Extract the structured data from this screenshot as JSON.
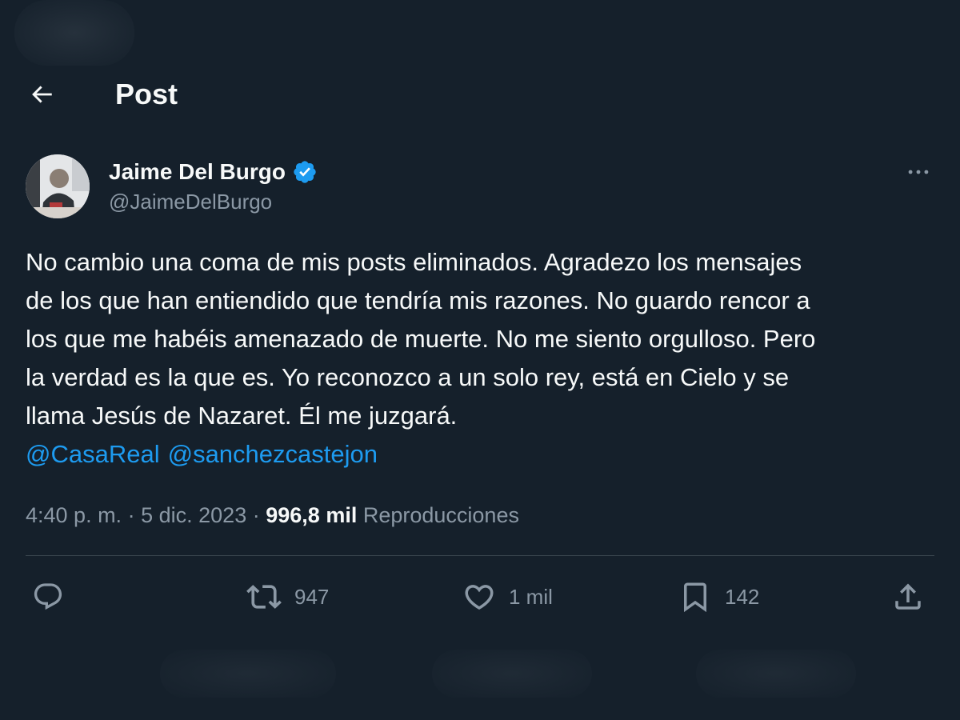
{
  "header": {
    "title": "Post",
    "back_icon": "arrow-left-icon"
  },
  "author": {
    "name": "Jaime Del Burgo",
    "handle": "@JaimeDelBurgo",
    "verified": true,
    "verified_color": "#1d9bf0"
  },
  "tweet": {
    "lines": [
      "No cambio una coma de mis posts eliminados. Agradezo los mensajes",
      "de los que han entiendido que tendría mis razones. No guardo rencor a",
      "los que me habéis amenazado de muerte. No me siento orgulloso. Pero",
      "la verdad es la que es. Yo reconozco a un solo rey, está en Cielo y se",
      "llama Jesús de Nazaret. Él me juzgará."
    ],
    "mentions": [
      "@CasaReal",
      "@sanchezcastejon"
    ]
  },
  "meta": {
    "time": "4:40 p. m.",
    "separator": "·",
    "date": "5 dic. 2023",
    "views_count": "996,8 mil",
    "views_label": "Reproducciones"
  },
  "actions": {
    "reply": {
      "icon": "reply-icon",
      "count": ""
    },
    "repost": {
      "icon": "repost-icon",
      "count": "947"
    },
    "like": {
      "icon": "heart-icon",
      "count": "1 mil"
    },
    "bookmark": {
      "icon": "bookmark-icon",
      "count": "142"
    },
    "share": {
      "icon": "share-icon",
      "count": ""
    }
  },
  "colors": {
    "background": "#15202b",
    "text": "#f7f9f9",
    "secondary": "#8b98a5",
    "accent": "#1d9bf0",
    "divider": "#38444d"
  }
}
